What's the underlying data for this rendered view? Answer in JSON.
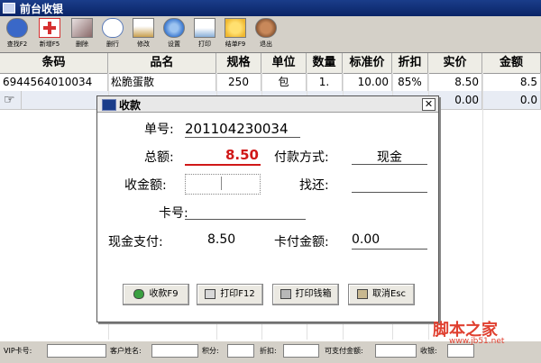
{
  "window": {
    "title": "前台收银"
  },
  "toolbar": {
    "buttons": [
      {
        "label": "查找F2",
        "icon": "help-icon",
        "color": "#3a68c8"
      },
      {
        "label": "新增F5",
        "icon": "add-cross-icon",
        "color": "#d63030"
      },
      {
        "label": "删除",
        "icon": "delete-icon",
        "color": "#8a6a6a"
      },
      {
        "label": "删行",
        "icon": "delete-row-icon",
        "color": "#5a7ab8"
      },
      {
        "label": "修改",
        "icon": "edit-icon",
        "color": "#c8a050"
      },
      {
        "label": "设置",
        "icon": "settings-icon",
        "color": "#3e7ad0"
      },
      {
        "label": "打印",
        "icon": "print-icon",
        "color": "#8ab0d8"
      },
      {
        "label": "结单F9",
        "icon": "checkout-icon",
        "color": "#f0b830"
      },
      {
        "label": "退出",
        "icon": "exit-icon",
        "color": "#7a4a2a"
      }
    ]
  },
  "grid": {
    "headers": [
      "条码",
      "品名",
      "规格",
      "单位",
      "数量",
      "标准价",
      "折扣",
      "实价",
      "金额"
    ],
    "rows": [
      [
        "6944564010034",
        "松脆蛋散",
        "250",
        "包",
        "1.",
        "10.00",
        "85%",
        "8.50",
        "8.5"
      ],
      [
        "",
        "",
        "",
        "",
        "",
        "",
        "",
        "0.00",
        "0.0"
      ]
    ]
  },
  "dialog": {
    "title": "收款",
    "order_label": "单号:",
    "order_no": "201104230034",
    "total_label": "总额:",
    "total": "8.50",
    "pay_method_label": "付款方式:",
    "pay_method": "现金",
    "received_label": "收金额:",
    "change_label": "找还:",
    "card_label": "卡号:",
    "cash_pay_label": "现金支付:",
    "cash_pay": "8.50",
    "card_pay_label": "卡付金额:",
    "card_pay": "0.00",
    "buttons": {
      "receive": "收款F9",
      "print": "打印F12",
      "drawer": "打印钱箱",
      "cancel": "取消Esc"
    },
    "total_color": "#d01818"
  },
  "statusbar": {
    "fields": [
      "VIP卡号:",
      "客户姓名:",
      "积分:",
      "折扣:",
      "可支付金额:",
      "收银:"
    ]
  },
  "watermark": {
    "main": "脚本之家",
    "sub": "www.jb51.net"
  }
}
